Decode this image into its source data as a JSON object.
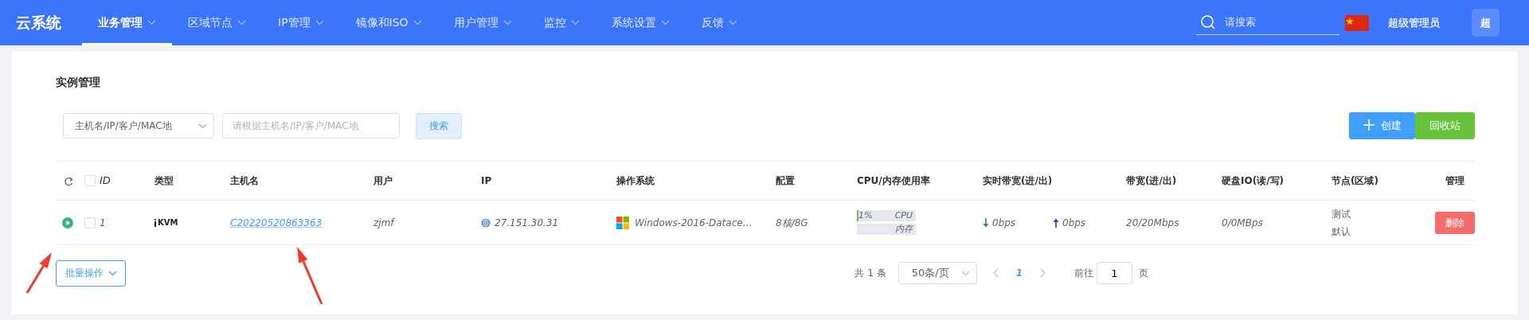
{
  "nav": {
    "logo": "云系统",
    "items": [
      {
        "label": "业务管理",
        "selected": true
      },
      {
        "label": "区域节点",
        "selected": false
      },
      {
        "label": "IP管理",
        "selected": false
      },
      {
        "label": "镜像和ISO",
        "selected": false
      },
      {
        "label": "用户管理",
        "selected": false
      },
      {
        "label": "监控",
        "selected": false
      },
      {
        "label": "系统设置",
        "selected": false
      },
      {
        "label": "反馈",
        "selected": false
      }
    ],
    "search": {
      "placeholder": "请搜索"
    },
    "user": "超级管理员",
    "avatar": "超"
  },
  "page": {
    "title": "实例管理"
  },
  "filter": {
    "field_select": "主机名/IP/客户/MAC地",
    "search_input": {
      "placeholder": "请根据主机名/IP/客户/MAC地"
    },
    "search_button": "搜索",
    "create_button": "创建",
    "recycle_button": "回收站"
  },
  "table": {
    "select_all_checked": false,
    "columns": [
      "ID",
      "类型",
      "主机名",
      "用户",
      "IP",
      "操作系统",
      "配置",
      "CPU/内存使用率",
      "实时带宽(进/出)",
      "带宽(进/出)",
      "硬盘IO(读/写)",
      "节点(区域)",
      "管理"
    ],
    "rows": [
      {
        "running": true,
        "checked": false,
        "id": "1",
        "type": "KVM",
        "hostname": "C20220520863363",
        "user": "zjmf",
        "ip": "27.151.30.31",
        "os": "Windows-2016-Datace…",
        "config": "8核/8G",
        "cpu": {
          "level": 0.01,
          "text": "1%",
          "label": "CPU"
        },
        "memory": {
          "level": 0,
          "label": "内存"
        },
        "bw_in": "0bps",
        "bw_out": "0bps",
        "bandwidth": "20/20Mbps",
        "disk_io": "0/0MBps",
        "node": "测试",
        "region": "默认",
        "action": "删除"
      }
    ]
  },
  "batch_button": "批量操作",
  "pagination": {
    "total": "共 1 条",
    "page_size": "50条/页",
    "pages": [
      {
        "label": "1",
        "selected": true
      }
    ],
    "goto_label": "前往",
    "goto_value": "1",
    "unit": "页"
  }
}
